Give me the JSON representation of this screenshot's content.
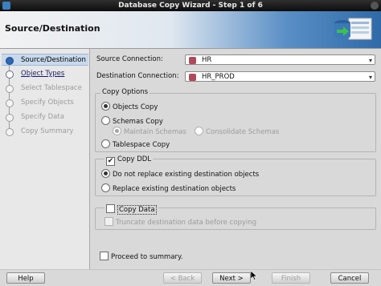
{
  "window": {
    "title": "Database Copy Wizard - Step 1 of 6"
  },
  "header": {
    "title": "Source/Destination"
  },
  "nav": {
    "items": [
      {
        "label": "Source/Destination",
        "state": "active"
      },
      {
        "label": "Object Types",
        "state": "enabled"
      },
      {
        "label": "Select Tablespace",
        "state": "disabled"
      },
      {
        "label": "Specify Objects",
        "state": "disabled"
      },
      {
        "label": "Specify Data",
        "state": "disabled"
      },
      {
        "label": "Copy Summary",
        "state": "disabled"
      }
    ]
  },
  "connections": {
    "source_label": "Source Connection:",
    "source_value": "HR",
    "destination_label": "Destination Connection:",
    "destination_value": "HR_PROD"
  },
  "copy_options": {
    "legend": "Copy Options",
    "objects_copy": "Objects Copy",
    "schemas_copy": "Schemas Copy",
    "maintain_schemas": "Maintain Schemas",
    "consolidate_schemas": "Consolidate Schemas",
    "tablespace_copy": "Tablespace Copy",
    "selected": "objects_copy"
  },
  "copy_ddl": {
    "label": "Copy DDL",
    "checked": true,
    "do_not_replace": "Do not replace existing destination objects",
    "replace": "Replace existing destination objects",
    "selected": "do_not_replace"
  },
  "copy_data": {
    "label": "Copy Data",
    "checked": false,
    "truncate": "Truncate destination data before copying"
  },
  "proceed_to_summary": {
    "label": "Proceed to summary.",
    "checked": false
  },
  "buttons": {
    "help": "Help",
    "back": "< Back",
    "next": "Next >",
    "finish": "Finish",
    "cancel": "Cancel"
  },
  "icons": {
    "checkmark": "✔",
    "chevron": "▾"
  },
  "colors": {
    "active_nav": "#c9d9ec",
    "header_accent": "#2f6aa8"
  }
}
